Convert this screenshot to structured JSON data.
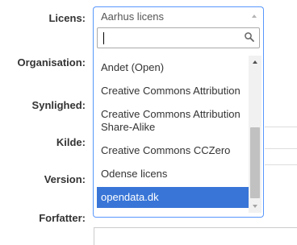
{
  "form": {
    "labels": {
      "license": "Licens:",
      "organisation": "Organisation:",
      "visibility": "Synlighed:",
      "source": "Kilde:",
      "version": "Version:",
      "author": "Forfatter:"
    }
  },
  "license_select": {
    "selected": "Aarhus licens",
    "search_value": "",
    "options": [
      "Andet (Open)",
      "Creative Commons Attribution",
      "Creative Commons Attribution Share-Alike",
      "Creative Commons CCZero",
      "Odense licens",
      "opendata.dk"
    ],
    "highlighted_index": 5
  },
  "colors": {
    "focus_border": "#5897fb",
    "highlight": "#3875d7",
    "label": "#333333"
  },
  "icons": {
    "search": "search-icon",
    "arrow": "chevron-up-icon"
  }
}
